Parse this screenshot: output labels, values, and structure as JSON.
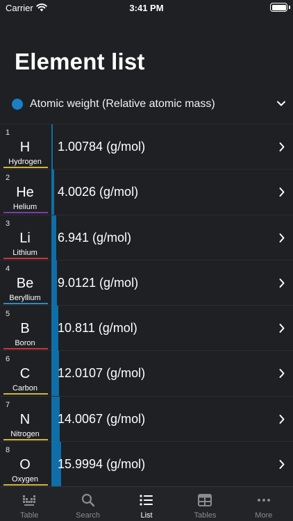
{
  "status_bar": {
    "carrier": "Carrier",
    "time": "3:41 PM"
  },
  "title": "Element list",
  "selector": {
    "label": "Atomic weight (Relative atomic mass)",
    "accent_color": "#1a7fc4"
  },
  "elements": [
    {
      "number": "1",
      "symbol": "H",
      "name": "Hydrogen",
      "value": "1.00784 (g/mol)",
      "weight": 1.00784,
      "category_color": "#d4b43a"
    },
    {
      "number": "2",
      "symbol": "He",
      "name": "Helium",
      "value": "4.0026 (g/mol)",
      "weight": 4.0026,
      "category_color": "#7b3ea8"
    },
    {
      "number": "3",
      "symbol": "Li",
      "name": "Lithium",
      "value": "6.941 (g/mol)",
      "weight": 6.941,
      "category_color": "#c9343a"
    },
    {
      "number": "4",
      "symbol": "Be",
      "name": "Beryllium",
      "value": "9.0121 (g/mol)",
      "weight": 9.0121,
      "category_color": "#2b8cc4"
    },
    {
      "number": "5",
      "symbol": "B",
      "name": "Boron",
      "value": "10.811 (g/mol)",
      "weight": 10.811,
      "category_color": "#c9343a"
    },
    {
      "number": "6",
      "symbol": "C",
      "name": "Carbon",
      "value": "12.0107 (g/mol)",
      "weight": 12.0107,
      "category_color": "#d4b43a"
    },
    {
      "number": "7",
      "symbol": "N",
      "name": "Nitrogen",
      "value": "14.0067 (g/mol)",
      "weight": 14.0067,
      "category_color": "#d4b43a"
    },
    {
      "number": "8",
      "symbol": "O",
      "name": "Oxygen",
      "value": "15.9994 (g/mol)",
      "weight": 15.9994,
      "category_color": "#d4b43a"
    }
  ],
  "tabs": [
    {
      "label": "Table",
      "icon": "periodic-table-icon",
      "active": false
    },
    {
      "label": "Search",
      "icon": "search-icon",
      "active": false
    },
    {
      "label": "List",
      "icon": "list-icon",
      "active": true
    },
    {
      "label": "Tables",
      "icon": "table-grid-icon",
      "active": false
    },
    {
      "label": "More",
      "icon": "more-icon",
      "active": false
    }
  ]
}
